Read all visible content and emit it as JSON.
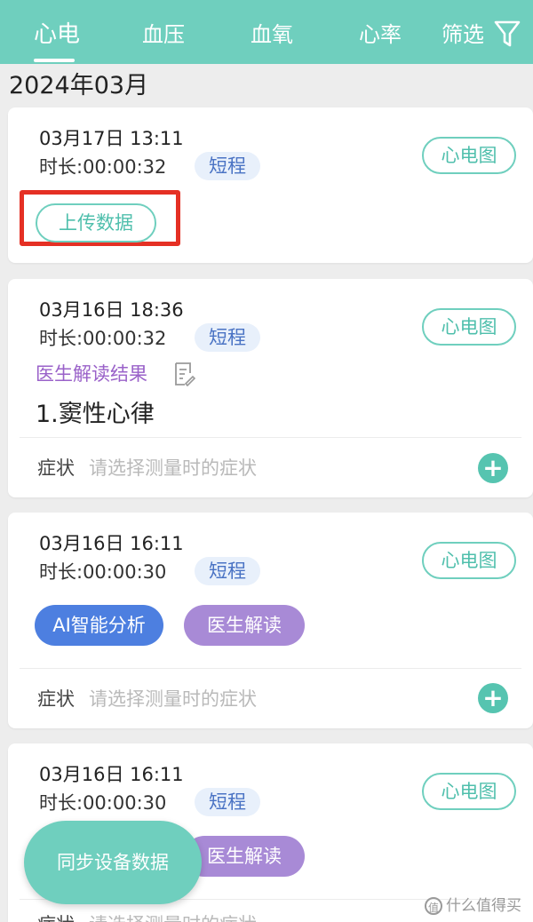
{
  "tabs": [
    {
      "label": "心电",
      "active": true
    },
    {
      "label": "血压",
      "active": false
    },
    {
      "label": "血氧",
      "active": false
    },
    {
      "label": "心率",
      "active": false
    }
  ],
  "filter": {
    "label": "筛选",
    "icon": "funnel-icon"
  },
  "month_header": "2024年03月",
  "records": [
    {
      "datetime": "03月17日 13:11",
      "duration": "时长:00:00:32",
      "type_tag": "短程",
      "ecg_button": "心电图",
      "upload_button": "上传数据"
    },
    {
      "datetime": "03月16日 18:36",
      "duration": "时长:00:00:32",
      "type_tag": "短程",
      "ecg_button": "心电图",
      "doctor_result_label": "医生解读结果",
      "diagnosis": "1.窦性心律",
      "symptom_label": "症状",
      "symptom_placeholder": "请选择测量时的症状"
    },
    {
      "datetime": "03月16日 16:11",
      "duration": "时长:00:00:30",
      "type_tag": "短程",
      "ecg_button": "心电图",
      "ai_button": "AI智能分析",
      "doctor_button": "医生解读",
      "symptom_label": "症状",
      "symptom_placeholder": "请选择测量时的症状"
    },
    {
      "datetime": "03月16日 16:11",
      "duration": "时长:00:00:30",
      "type_tag": "短程",
      "ecg_button": "心电图",
      "doctor_button": "医生解读",
      "symptom_label": "症状",
      "symptom_placeholder": "请选择测量时的症状"
    }
  ],
  "sync_button": "同步设备数据",
  "watermark": "什么值得买",
  "colors": {
    "accent": "#6fcfbe",
    "ai_blue": "#4d7fe0",
    "doctor_purple": "#a88ad6",
    "highlight_red": "#e53024"
  }
}
